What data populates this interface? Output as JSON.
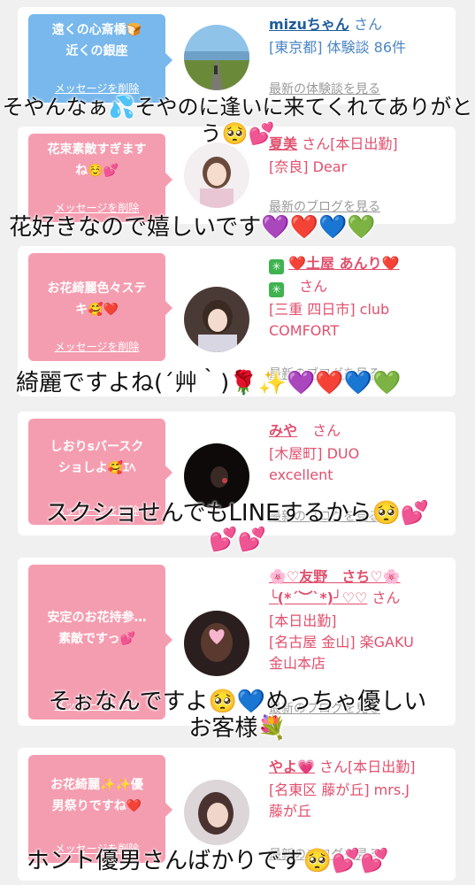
{
  "delete_label": "メッセージを削除",
  "cards": [
    {
      "bubble": "遠くの心斎橋🍞\n近くの銀座",
      "name": "mizuちゃん",
      "san": "さん",
      "details": "[東京都] 体験談 86件",
      "latest": "最新の体験談を見る",
      "overlay": "そやんなぁ💦そやのに逢いに来てくれてありがと\nう🥺💕"
    },
    {
      "bubble": "花束素敵すぎます\nね☺️💕",
      "name": "夏美",
      "san": "さん[本日出勤]",
      "details": "[奈良] Dear",
      "latest": "最新のブログを見る",
      "overlay": "花好きなので嬉しいです💜❤️💙💚"
    },
    {
      "bubble": "お花綺麗色々ステ\nキ🥰❤️",
      "name_prefix": "✳",
      "name": "❤️土屋 あんり❤️",
      "name_line2": "✳",
      "san": "さん",
      "details": "[三重 四日市] club\nCOMFORT",
      "latest": "最新のブログを見る",
      "overlay": "綺麗ですよね(´艸｀)🌹✨💜❤️💙💚"
    },
    {
      "bubble": "しおりsバースク\nショしよ🥰ｴﾍ",
      "name": "みや",
      "san": "さん",
      "details": "[木屋町] DUO\nexcellent",
      "latest": "最新のブログを見る",
      "overlay": "スクショせんでもLINEするから🥺💕\n💕💕"
    },
    {
      "bubble": "安定のお花持参…\n素敵ですっ💕",
      "name": "🌸♡友野　さち♡🌸\n╰(*´︶`*)╯♡♡",
      "san": "さん",
      "details": "[本日出勤]\n[名古屋 金山] 楽GAKU\n金山本店",
      "latest": "最新のブログを見る",
      "overlay": "そぉなんですよ🥺💙めっちゃ優しい\nお客様💐"
    },
    {
      "bubble": "お花綺麗✨✨優\n男祭りですね❤️",
      "name": "やよ💗",
      "san": "さん[本日出勤]",
      "details": "[名東区 藤が丘] mrs.J\n藤が丘",
      "latest": "最新のブログを見る",
      "overlay": "ホント優男さんばかりです🥺💕💕"
    }
  ]
}
